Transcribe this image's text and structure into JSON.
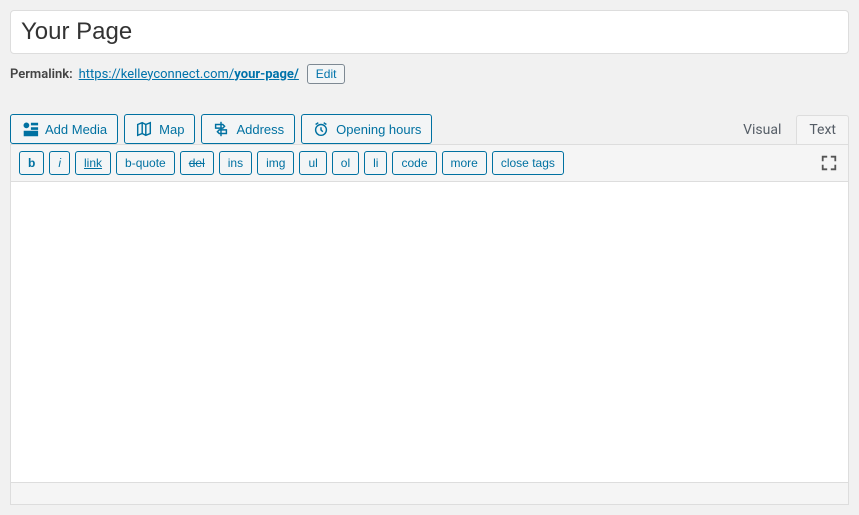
{
  "title": {
    "value": "Your Page"
  },
  "permalink": {
    "label": "Permalink:",
    "base": "https://kelleyconnect.com/",
    "slug": "your-page/",
    "edit_label": "Edit"
  },
  "media_buttons": {
    "add_media": "Add Media",
    "map": "Map",
    "address": "Address",
    "opening_hours": "Opening hours"
  },
  "tabs": {
    "visual": "Visual",
    "text": "Text",
    "active": "text"
  },
  "quicktags": {
    "b": "b",
    "i": "i",
    "link": "link",
    "bquote": "b-quote",
    "del": "del",
    "ins": "ins",
    "img": "img",
    "ul": "ul",
    "ol": "ol",
    "li": "li",
    "code": "code",
    "more": "more",
    "close": "close tags"
  },
  "editor": {
    "content": ""
  }
}
